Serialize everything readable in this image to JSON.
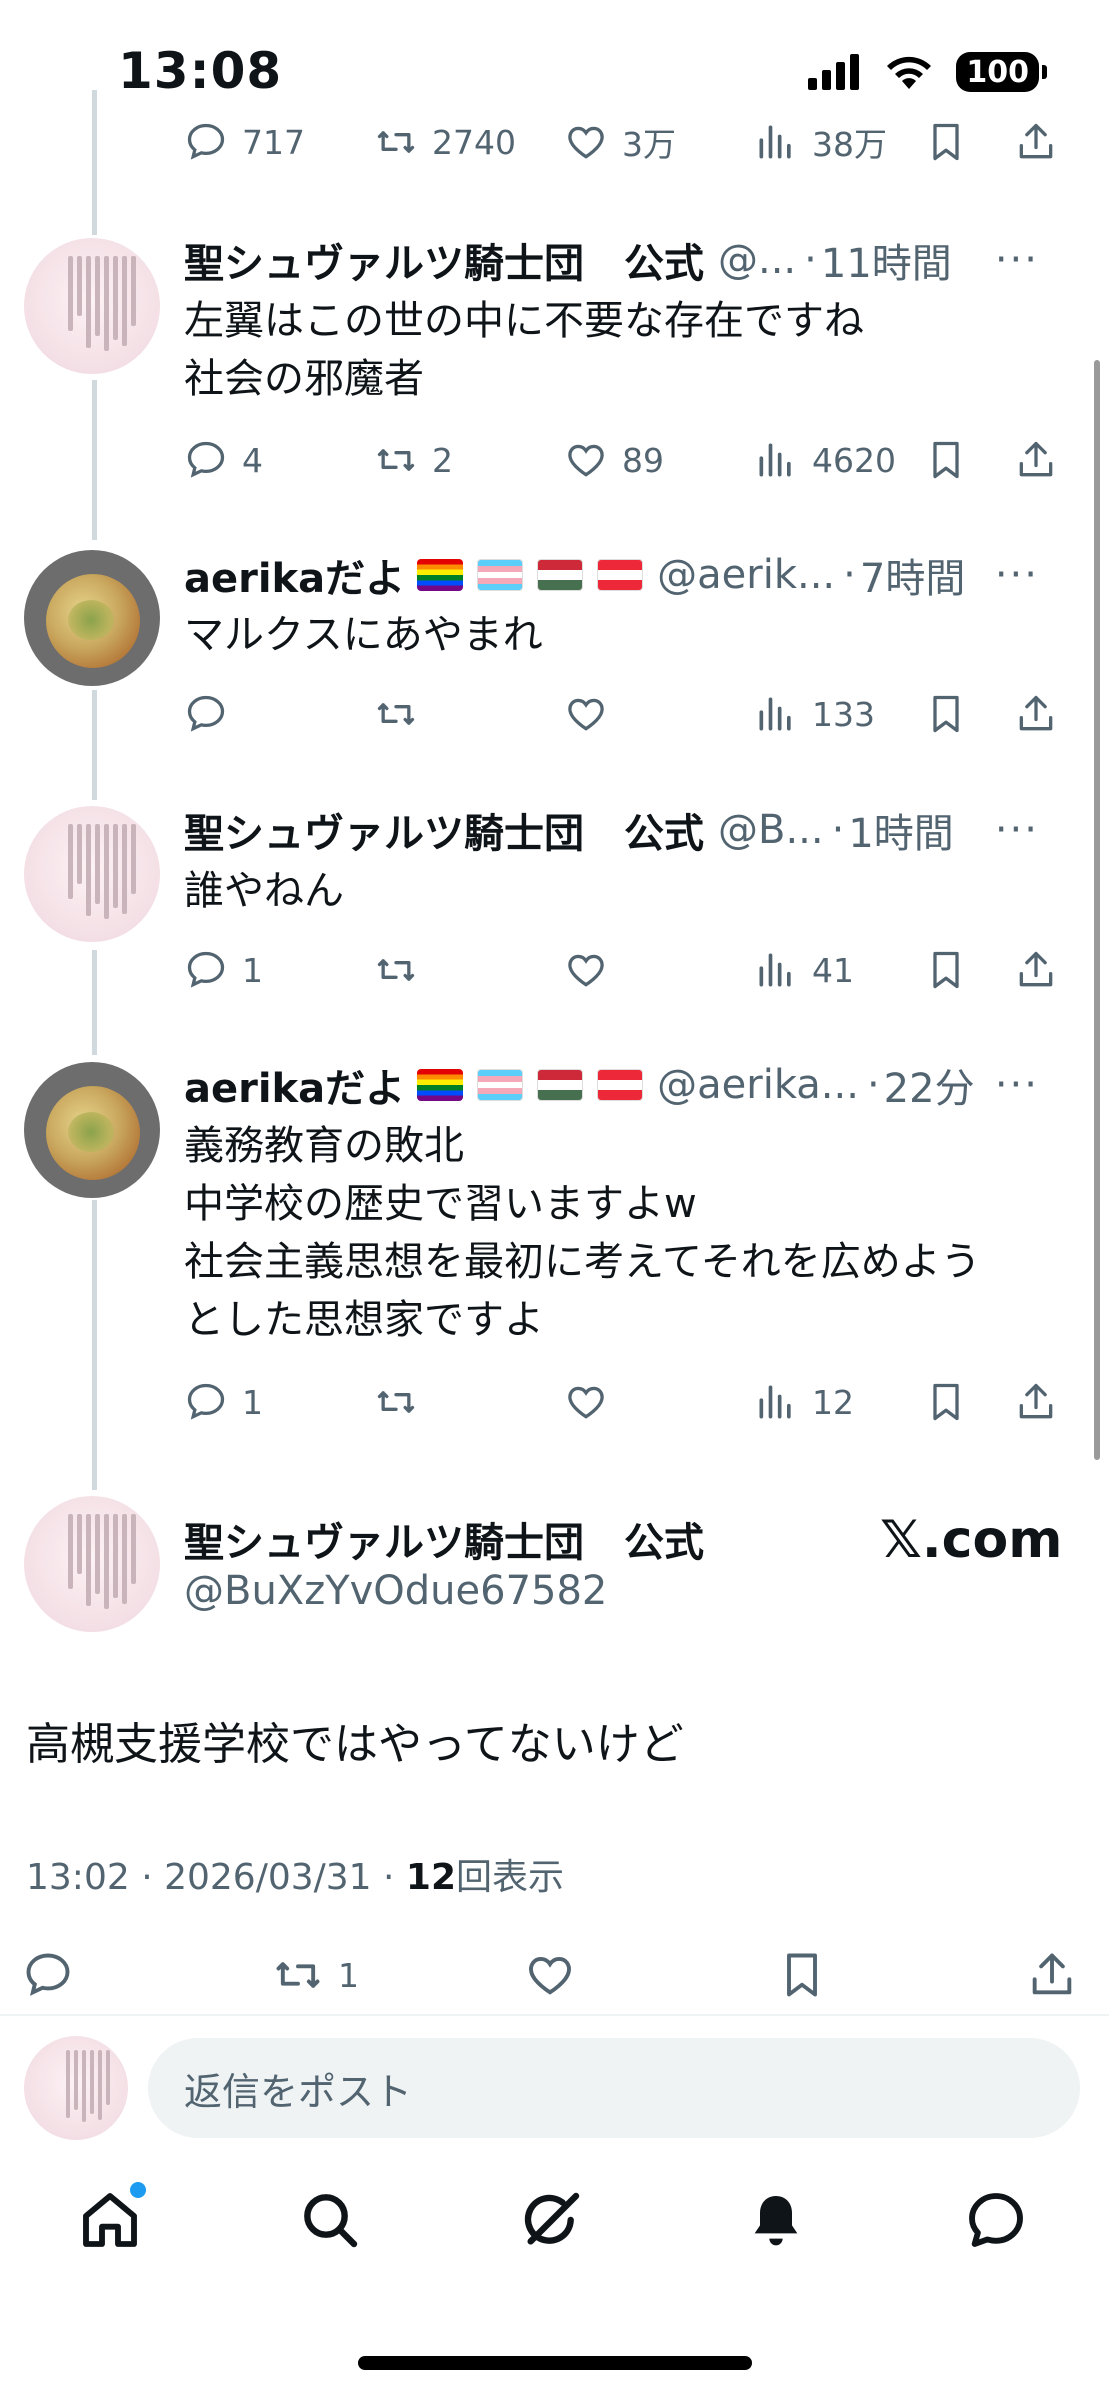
{
  "status_bar": {
    "time": "13:08",
    "battery": "100"
  },
  "partial_tweet": {
    "replies": "717",
    "retweets": "2740",
    "likes": "3万",
    "views": "38万"
  },
  "tweets": [
    {
      "name": "聖シュヴァルツ騎士団　公式",
      "handle": "@...",
      "time": "11時間",
      "lines": [
        "左翼はこの世の中に不要な存在ですね",
        "社会の邪魔者"
      ],
      "replies": "4",
      "retweets": "2",
      "likes": "89",
      "views": "4620"
    },
    {
      "name": "aerikaだよ",
      "handle": "@aerik...",
      "time": "7時間",
      "lines": [
        "マルクスにあやまれ"
      ],
      "replies": "",
      "retweets": "",
      "likes": "",
      "views": "133"
    },
    {
      "name": "聖シュヴァルツ騎士団　公式",
      "handle": "@B...",
      "time": "1時間",
      "lines": [
        "誰やねん"
      ],
      "replies": "1",
      "retweets": "",
      "likes": "",
      "views": "41"
    },
    {
      "name": "aerikaだよ",
      "handle": "@aerika...",
      "time": "22分",
      "lines": [
        "義務教育の敗北",
        "中学校の歴史で習いますよw",
        "社会主義思想を最初に考えてそれを広めよう",
        "とした思想家ですよ"
      ],
      "replies": "1",
      "retweets": "",
      "likes": "",
      "views": "12"
    }
  ],
  "main_tweet": {
    "name": "聖シュヴァルツ騎士団　公式",
    "handle": "@BuXzYvOdue67582",
    "badge": "𝕏.com",
    "text": "高槻支援学校ではやってないけど",
    "meta_prefix": "13:02 · 2026/03/31 · ",
    "views_count": "12",
    "views_label": "回表示",
    "retweets": "1"
  },
  "reply_bar": {
    "placeholder": "返信をポスト"
  },
  "icons": {
    "reply": "reply-icon",
    "retweet": "retweet-icon",
    "like": "heart-icon",
    "views": "views-icon",
    "bookmark": "bookmark-icon",
    "share": "share-icon",
    "more": "more-icon",
    "nav": [
      "home-icon",
      "search-icon",
      "grok-icon",
      "notifications-icon",
      "messages-icon"
    ]
  },
  "colors": {
    "accent": "#1d9bf0",
    "secondary_text": "#536471",
    "thread_line": "#cfd9de"
  }
}
